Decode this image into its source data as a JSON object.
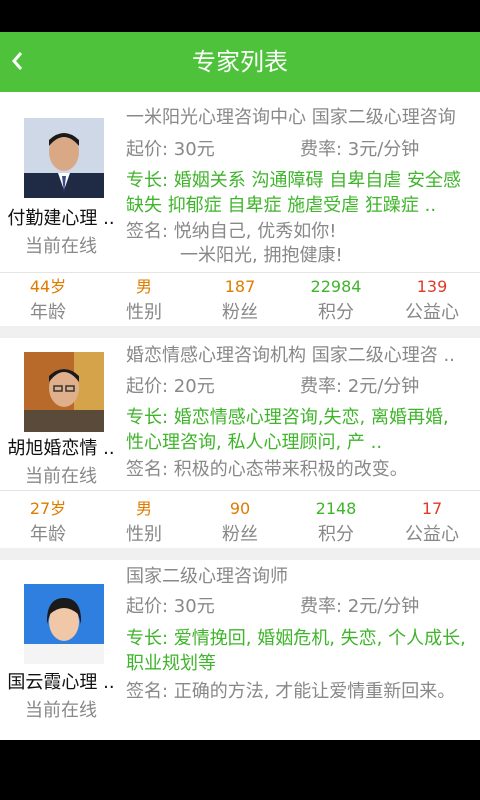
{
  "header": {
    "back_icon": "chevron-left-icon",
    "title": "专家列表"
  },
  "colors": {
    "brand_green": "#4fc23c",
    "age": "#e07b00",
    "gender": "#e07b00",
    "fans": "#e07b00",
    "points": "#3fb52b",
    "charity": "#e03a2a"
  },
  "experts": [
    {
      "name": "付勤建心理 ..",
      "status": "当前在线",
      "title": "一米阳光心理咨询中心  国家二级心理咨询",
      "price": "起价: 30元",
      "rate": "费率: 3元/分钟",
      "specialty": "专长: 婚姻关系  沟通障碍  自卑自虐 安全感缺失 抑郁症 自卑症 施虐受虐 狂躁症 ..",
      "signature": "签名: 悦纳自己, 优秀如你!\n　　　一米阳光, 拥抱健康!",
      "stats": [
        {
          "value": "44岁",
          "label": "年龄"
        },
        {
          "value": "男",
          "label": "性别"
        },
        {
          "value": "187",
          "label": "粉丝"
        },
        {
          "value": "22984",
          "label": "积分"
        },
        {
          "value": "139",
          "label": "公益心"
        }
      ]
    },
    {
      "name": "胡旭婚恋情 ..",
      "status": "当前在线",
      "title": "婚恋情感心理咨询机构  国家二级心理咨 ..",
      "price": "起价: 20元",
      "rate": "费率: 2元/分钟",
      "specialty": "专长: 婚恋情感心理咨询,失恋, 离婚再婚, 性心理咨询, 私人心理顾问, 产 ..",
      "signature": "签名: 积极的心态带来积极的改变。",
      "stats": [
        {
          "value": "27岁",
          "label": "年龄"
        },
        {
          "value": "男",
          "label": "性别"
        },
        {
          "value": "90",
          "label": "粉丝"
        },
        {
          "value": "2148",
          "label": "积分"
        },
        {
          "value": "17",
          "label": "公益心"
        }
      ]
    },
    {
      "name": "国云霞心理 ..",
      "status": "当前在线",
      "title": " 国家二级心理咨询师",
      "price": "起价: 30元",
      "rate": "费率: 2元/分钟",
      "specialty": "专长: 爱情挽回, 婚姻危机, 失恋, 个人成长, 职业规划等",
      "signature": "签名: 正确的方法, 才能让爱情重新回来。"
    }
  ]
}
